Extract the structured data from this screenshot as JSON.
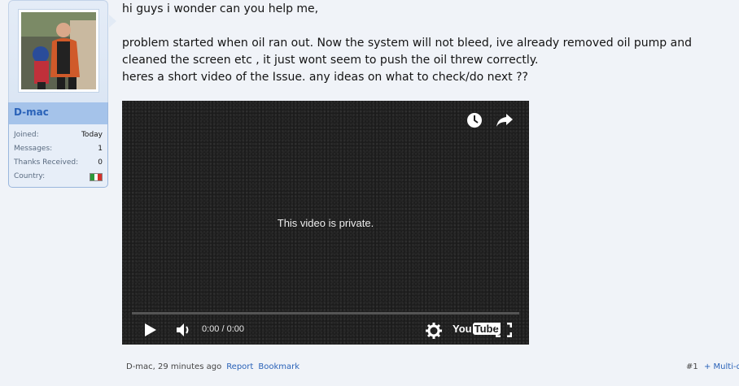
{
  "user": {
    "name": "D-mac",
    "stats": [
      {
        "label": "Joined:",
        "value": "Today"
      },
      {
        "label": "Messages:",
        "value": "1"
      },
      {
        "label": "Thanks Received:",
        "value": "0"
      },
      {
        "label": "Country:",
        "value": ""
      }
    ],
    "flag_colors": [
      "#2d9a3a",
      "#ffffff",
      "#d4312b"
    ]
  },
  "message": {
    "line1": "hi guys i wonder can you help me,",
    "line2": "problem started when oil ran out. Now the system will not bleed, ive already removed oil pump and",
    "line3": "cleaned the screen etc , it just wont seem to push the oil threw correctly.",
    "line4": "heres a short video of the Issue. any ideas on what to check/do next ??"
  },
  "video": {
    "status_text": "This video is private.",
    "time": "0:00 / 0:00",
    "logo_you": "You",
    "logo_tube": "Tube",
    "icons": [
      "clock-icon",
      "share-icon",
      "play-icon",
      "volume-icon",
      "settings-icon",
      "fullscreen-icon"
    ]
  },
  "footer": {
    "author_time": "D-mac, 29 minutes ago",
    "report": "Report",
    "bookmark": "Bookmark",
    "post_number": "#1",
    "multiquote": "+ Multi-q"
  }
}
